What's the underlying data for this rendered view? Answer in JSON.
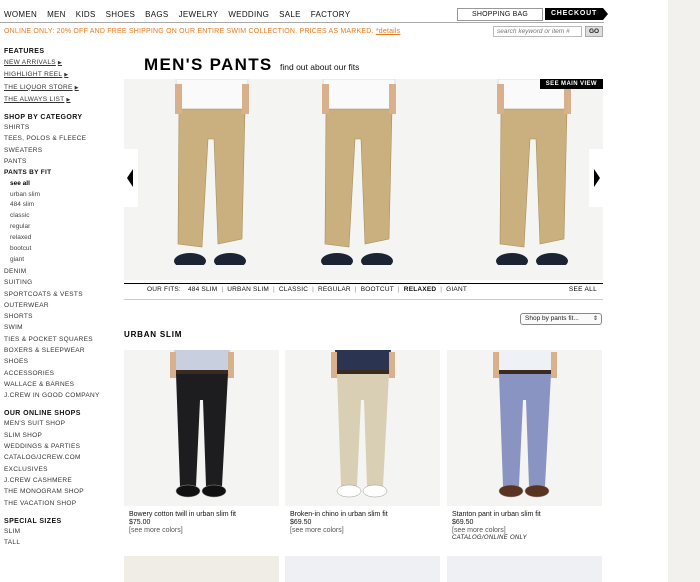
{
  "nav": {
    "categories": [
      "WOMEN",
      "MEN",
      "KIDS",
      "SHOES",
      "BAGS",
      "JEWELRY",
      "WEDDING",
      "SALE",
      "FACTORY"
    ],
    "shopping_bag": "SHOPPING BAG",
    "checkout": "CHECKOUT"
  },
  "promo": {
    "text": "ONLINE ONLY: 20% OFF AND FREE SHIPPING ON OUR ENTIRE SWIM COLLECTION. PRICES AS MARKED.",
    "link": "*details"
  },
  "search": {
    "placeholder": "search keyword or item #",
    "go": "GO"
  },
  "sidebar": {
    "features_heading": "FEATURES",
    "features": [
      "NEW ARRIVALS",
      "HIGHLIGHT REEL",
      "THE LIQUOR STORE",
      "THE ALWAYS LIST"
    ],
    "category_heading": "SHOP BY CATEGORY",
    "cats_top": [
      "SHIRTS",
      "TEES, POLOS & FLEECE",
      "SWEATERS",
      "PANTS"
    ],
    "pants_by_fit": "PANTS BY FIT",
    "fits": [
      "see all",
      "urban slim",
      "484 slim",
      "classic",
      "regular",
      "relaxed",
      "bootcut",
      "giant"
    ],
    "cats_bottom": [
      "DENIM",
      "SUITING",
      "SPORTCOATS & VESTS",
      "OUTERWEAR",
      "SHORTS",
      "SWIM",
      "TIES & POCKET SQUARES",
      "BOXERS & SLEEPWEAR",
      "SHOES",
      "ACCESSORIES",
      "WALLACE & BARNES",
      "J.CREW IN GOOD COMPANY"
    ],
    "online_heading": "OUR ONLINE SHOPS",
    "online": [
      "MEN'S SUIT SHOP",
      "SLIM SHOP",
      "WEDDINGS & PARTIES",
      "CATALOG/JCREW.COM",
      "EXCLUSIVES",
      "J.CREW CASHMERE",
      "THE MONOGRAM SHOP",
      "THE VACATION SHOP"
    ],
    "sizes_heading": "SPECIAL SIZES",
    "sizes": [
      "SLIM",
      "TALL"
    ]
  },
  "main": {
    "title": "MEN'S PANTS",
    "subtitle": "find out about our fits",
    "see_main_view": "SEE MAIN VIEW",
    "our_fits_label": "OUR FITS:",
    "fits": [
      "484 SLIM",
      "URBAN SLIM",
      "CLASSIC",
      "REGULAR",
      "BOOTCUT",
      "RELAXED",
      "GIANT"
    ],
    "see_all": "SEE ALL",
    "shop_by_select": "Shop by pants fit...",
    "section_title": "URBAN SLIM"
  },
  "products": [
    {
      "name": "Bowery cotton twill in urban slim fit",
      "price": "$75.00",
      "more": "[see more colors]",
      "note": "",
      "pant_color": "#1d1d1f",
      "shirt_color": "#c8d0e0",
      "shoe_color": "#111111"
    },
    {
      "name": "Broken-in chino in urban slim fit",
      "price": "$69.50",
      "more": "[see more colors]",
      "note": "",
      "pant_color": "#d8cfb4",
      "shirt_color": "#2b3552",
      "shoe_color": "#ffffff"
    },
    {
      "name": "Stanton pant in urban slim fit",
      "price": "$69.50",
      "more": "[see more colors]",
      "note": "CATALOG/ONLINE ONLY",
      "pant_color": "#8a94c2",
      "shirt_color": "#eef1f6",
      "shoe_color": "#5a3322"
    }
  ],
  "colors": {
    "accent_orange": "#e87a1e",
    "khaki": "#c9b07e"
  }
}
